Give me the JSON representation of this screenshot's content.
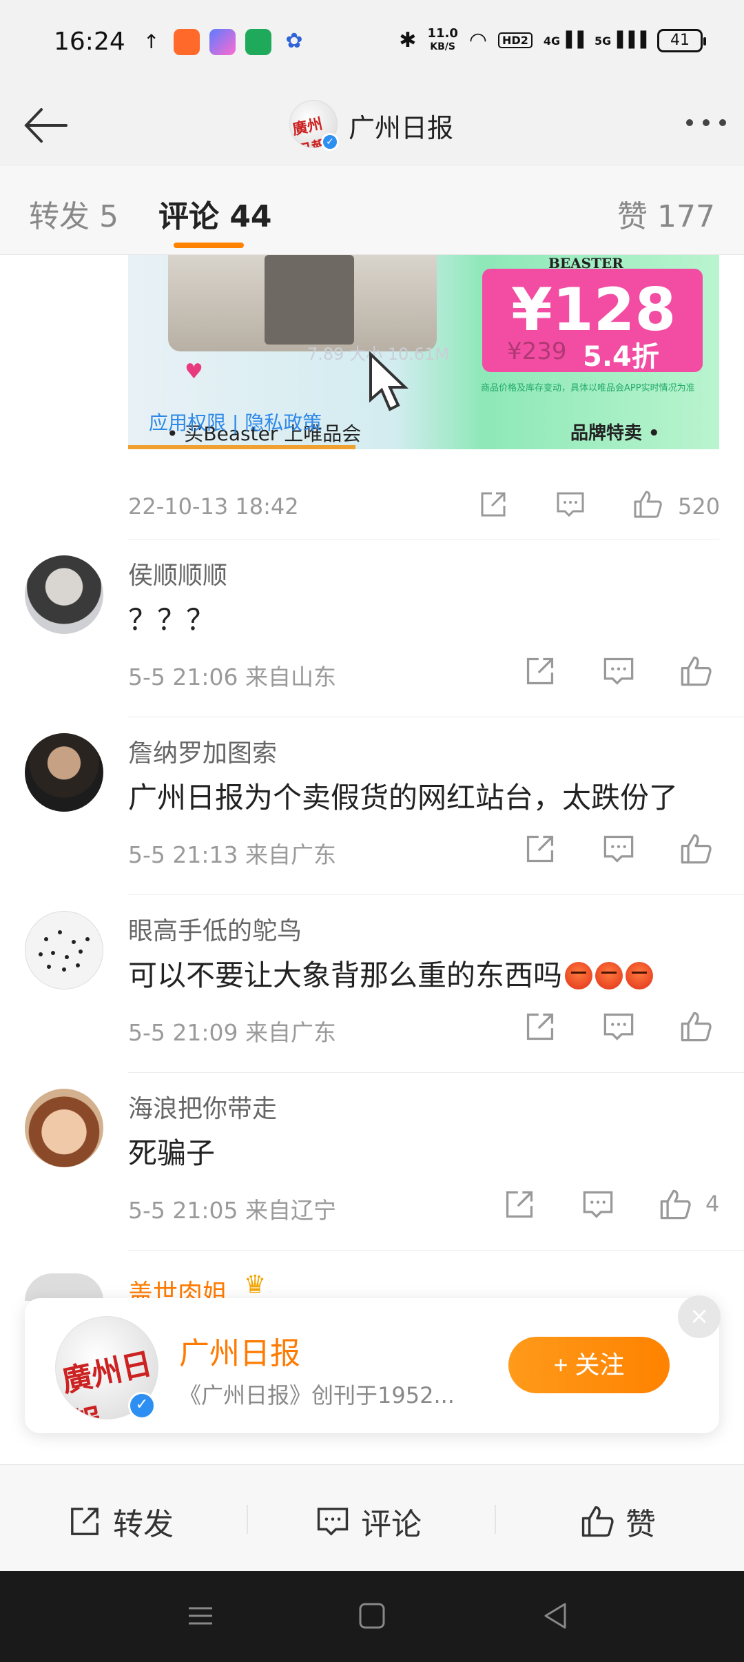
{
  "status_bar": {
    "time": "16:24",
    "net_speed_value": "11.0",
    "net_speed_unit": "KB/S",
    "hd_badge": "HD2",
    "net_4g": "4G",
    "net_5g": "5G",
    "battery": "41"
  },
  "nav": {
    "title": "广州日报"
  },
  "tabs": [
    {
      "label": "转发 5"
    },
    {
      "label": "评论 44"
    },
    {
      "label": "赞 177"
    }
  ],
  "media": {
    "brand": "BEASTER",
    "price": "¥128",
    "orig_price": "¥239",
    "discount": "5.4折",
    "fine_print": "商品价格及库存变动，具体以唯品会APP实时情况为准",
    "overlay_text": "7.89  大小  10.61M",
    "policy_link": "应用权限 | 隐私政策",
    "caption_left": "• 买Beaster 上唯品会",
    "caption_right": "品牌特卖 •"
  },
  "post": {
    "date": "22-10-13 18:42",
    "like_count": "520"
  },
  "comments": [
    {
      "name": "侯顺顺顺",
      "text": "？？？",
      "meta": "5-5 21:06  来自山东",
      "likes": ""
    },
    {
      "name": "詹纳罗加图索",
      "text": "广州日报为个卖假货的网红站台，太跌份了",
      "meta": "5-5 21:13  来自广东",
      "likes": ""
    },
    {
      "name": "眼高手低的鸵鸟",
      "text": "可以不要让大象背那么重的东西吗",
      "meta": "5-5 21:09  来自广东",
      "likes": ""
    },
    {
      "name": "海浪把你带走",
      "text": "死骗子",
      "meta": "5-5 21:05  来自辽宁",
      "likes": "4"
    }
  ],
  "peek_comment_name": "盖世肉姐",
  "follow_card": {
    "name": "广州日报",
    "desc": "《广州日报》创刊于1952...",
    "follow_label": "+ 关注",
    "close": "×",
    "avatar_text": "廣州日報"
  },
  "bottom_bar": {
    "repost": "转发",
    "comment": "评论",
    "like": "赞"
  },
  "colors": {
    "accent": "#ff8200",
    "verified": "#2e8ff2"
  }
}
